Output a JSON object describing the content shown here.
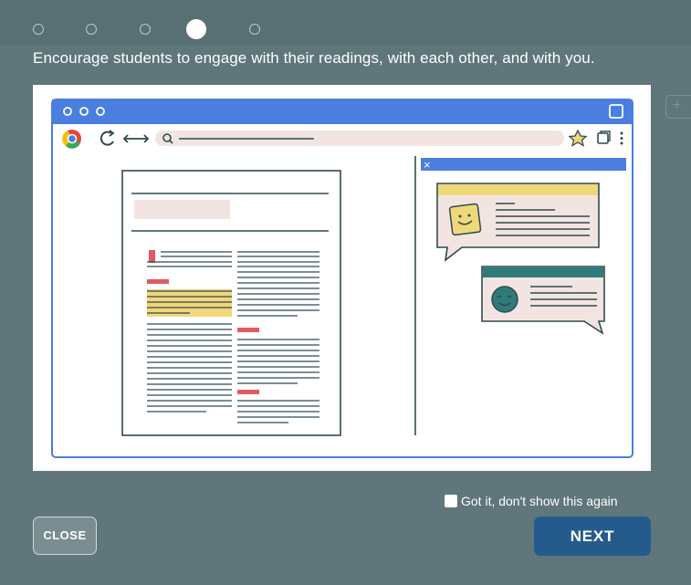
{
  "progress": {
    "steps_total": 5,
    "current_step": 4
  },
  "headline": "Encourage students to engage with their readings, with each other, and with you.",
  "illustration": {
    "close_glyph": "×"
  },
  "dont_show": {
    "label": "Got it, don't show this again",
    "checked": false
  },
  "buttons": {
    "close_label": "CLOSE",
    "next_label": "NEXT"
  },
  "peek_glyph": "+",
  "colors": {
    "overlay": "#5f767b",
    "next_button": "#245b8c",
    "browser_blue": "#4a7fe0",
    "highlight_yellow": "#f0d77a",
    "annotation_red": "#e05b63",
    "comment_teal": "#2f7b7a"
  }
}
